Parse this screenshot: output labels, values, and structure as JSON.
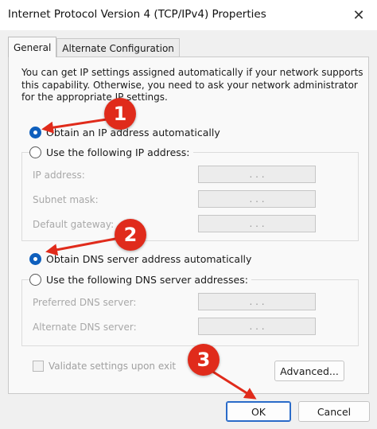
{
  "window": {
    "title": "Internet Protocol Version 4 (TCP/IPv4) Properties",
    "close_glyph": "✕"
  },
  "tabs": [
    {
      "label": "General",
      "active": true
    },
    {
      "label": "Alternate Configuration",
      "active": false
    }
  ],
  "intro_text": "You can get IP settings assigned automatically if your network supports this capability. Otherwise, you need to ask your network administrator for the appropriate IP settings.",
  "ip_section": {
    "auto_label": "Obtain an IP address automatically",
    "manual_label": "Use the following IP address:",
    "selected": "auto",
    "fields": [
      {
        "label": "IP address:",
        "value": ". . ."
      },
      {
        "label": "Subnet mask:",
        "value": ". . ."
      },
      {
        "label": "Default gateway:",
        "value": ". . ."
      }
    ]
  },
  "dns_section": {
    "auto_label": "Obtain DNS server address automatically",
    "manual_label": "Use the following DNS server addresses:",
    "selected": "auto",
    "fields": [
      {
        "label": "Preferred DNS server:",
        "value": ". . ."
      },
      {
        "label": "Alternate DNS server:",
        "value": ". . ."
      }
    ]
  },
  "validate_label": "Validate settings upon exit",
  "buttons": {
    "advanced": "Advanced...",
    "ok": "OK",
    "cancel": "Cancel"
  },
  "callouts": [
    "1",
    "2",
    "3"
  ],
  "colors": {
    "accent": "#0f5fbd",
    "callout": "#e02b1b"
  }
}
